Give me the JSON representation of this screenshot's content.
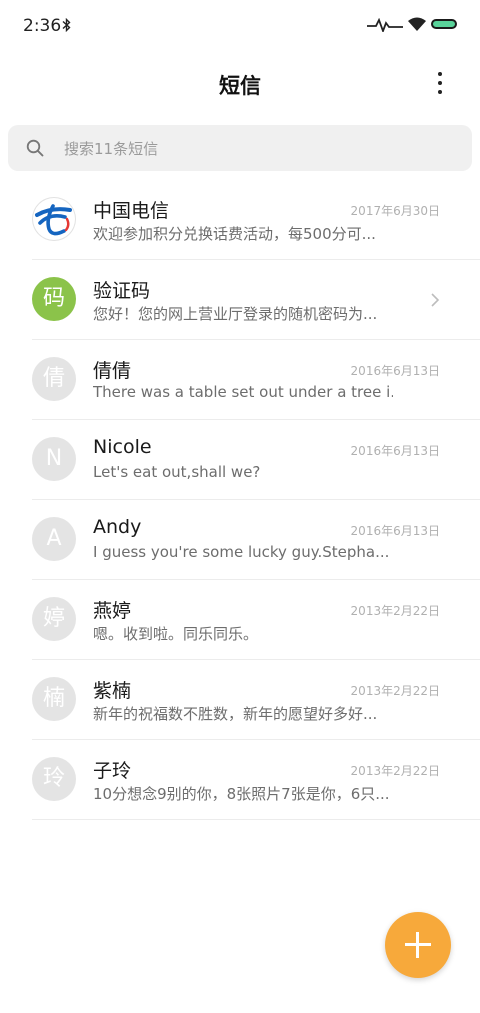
{
  "status_bar": {
    "time": "2:36",
    "icons": [
      "bluetooth-icon",
      "signal-pulse-icon",
      "wifi-icon",
      "battery-icon"
    ],
    "battery_color": "#59d39a"
  },
  "header": {
    "title": "短信",
    "menu_icon": "more-vertical-icon"
  },
  "search": {
    "placeholder": "搜索11条短信",
    "value": "",
    "icon": "search-icon"
  },
  "messages": [
    {
      "avatar": "",
      "avatar_type": "china-telecom-logo",
      "name": "中国电信",
      "preview": "欢迎参加积分兑换话费活动，每500分可...",
      "date": "2017年6月30日"
    },
    {
      "avatar": "码",
      "avatar_color": "#8bc34a",
      "name": "验证码",
      "preview": "您好！您的网上营业厅登录的随机密码为...",
      "date": "",
      "trailing_icon": "chevron-right-icon"
    },
    {
      "avatar": "倩",
      "name": "倩倩",
      "preview": "There was a table set out under a tree i...",
      "date": "2016年6月13日"
    },
    {
      "avatar": "N",
      "name": "Nicole",
      "preview": "Let's eat out,shall we?",
      "date": "2016年6月13日"
    },
    {
      "avatar": "A",
      "name": "Andy",
      "preview": "I guess you're some lucky guy.Stepha...",
      "date": "2016年6月13日"
    },
    {
      "avatar": "婷",
      "name": "燕婷",
      "preview": "嗯。收到啦。同乐同乐。",
      "date": "2013年2月22日"
    },
    {
      "avatar": "楠",
      "name": "紫楠",
      "preview": "新年的祝福数不胜数，新年的愿望好多好...",
      "date": "2013年2月22日"
    },
    {
      "avatar": "玲",
      "name": "子玲",
      "preview": "10分想念9别的你，8张照片7张是你，6只...",
      "date": "2013年2月22日"
    }
  ],
  "fab": {
    "icon": "plus-icon",
    "color": "#f7a93b"
  }
}
